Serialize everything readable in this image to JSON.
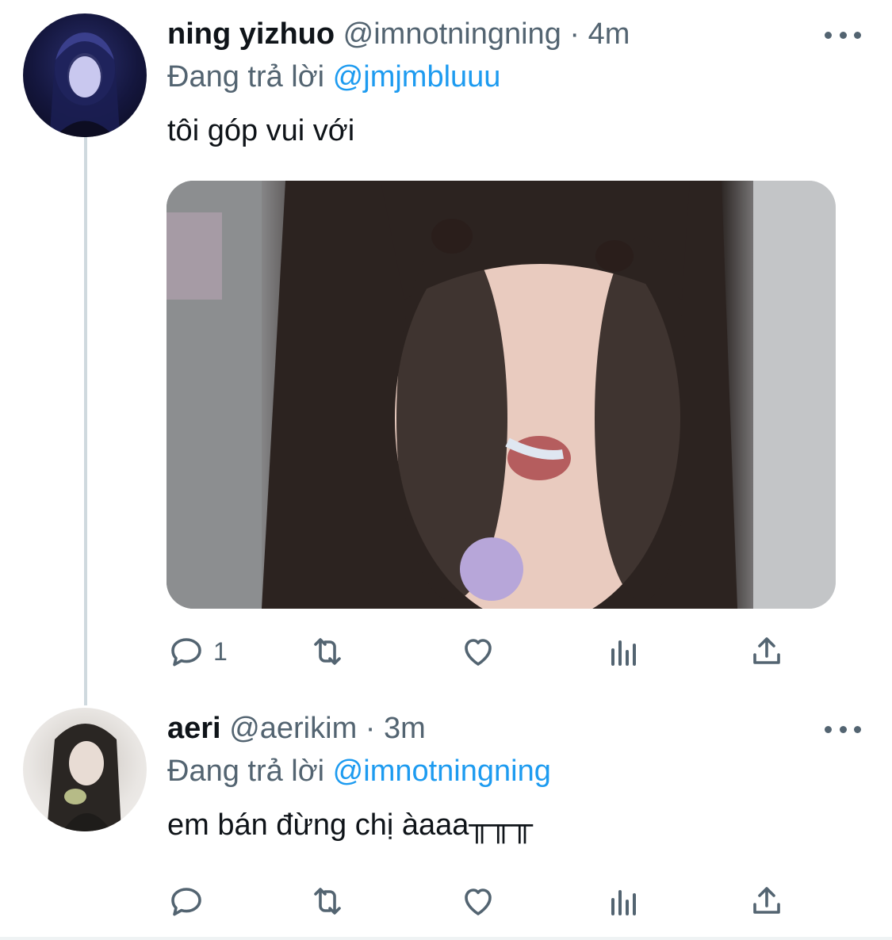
{
  "tweets": [
    {
      "name": "ning yizhuo",
      "handle": "@imnotningning",
      "separator": "·",
      "time": "4m",
      "replying_prefix": "Đang trả lời",
      "replying_to": "@jmjmbluuu",
      "text": "tôi góp vui với",
      "reply_count": "1",
      "avatar_icon": "avatar-image",
      "media_icon": "photo"
    },
    {
      "name": "aeri",
      "handle": "@aerikim",
      "separator": "·",
      "time": "3m",
      "replying_prefix": "Đang trả lời",
      "replying_to": "@imnotningning",
      "text": "em bán đừng chị àaaa╥╥╥",
      "reply_count": "",
      "avatar_icon": "avatar-image"
    }
  ],
  "icons": {
    "reply": "reply-icon",
    "retweet": "retweet-icon",
    "like": "heart-icon",
    "views": "analytics-icon",
    "share": "share-icon",
    "more": "more-icon"
  },
  "colors": {
    "accent": "#1d9bf0",
    "secondary_text": "#536471",
    "primary_text": "#0f1419",
    "thread_line": "#cfd9de"
  }
}
